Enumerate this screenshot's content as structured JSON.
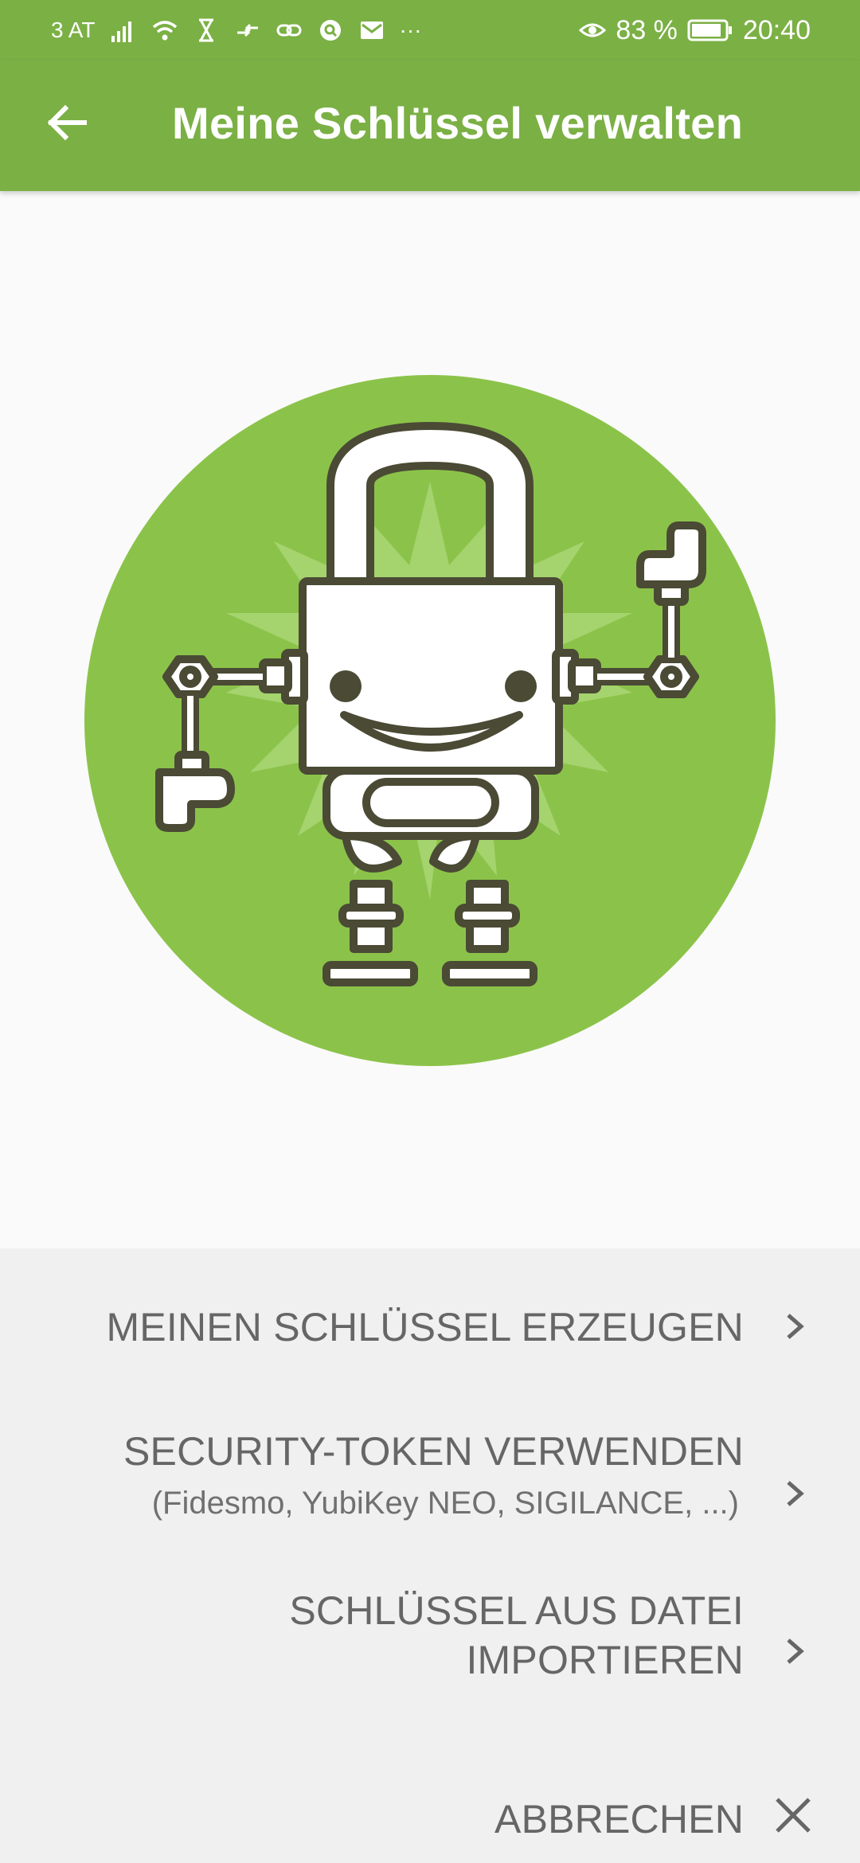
{
  "status_bar": {
    "carrier": "3 AT",
    "battery_percent": "83 %",
    "time": "20:40",
    "more_indicator": "···"
  },
  "toolbar": {
    "title": "Meine Schlüssel verwalten"
  },
  "illustration": {
    "accent_color": "#8bc34a",
    "outline_color": "#4a4a35"
  },
  "actions": {
    "create_key": "MEINEN SCHLÜSSEL ERZEUGEN",
    "use_token": "SECURITY-TOKEN VERWENDEN",
    "use_token_sub": "(Fidesmo, YubiKey NEO, SIGILANCE, ...)",
    "import_file": "SCHLÜSSEL AUS DATEI\nIMPORTIEREN",
    "cancel": "ABBRECHEN"
  }
}
